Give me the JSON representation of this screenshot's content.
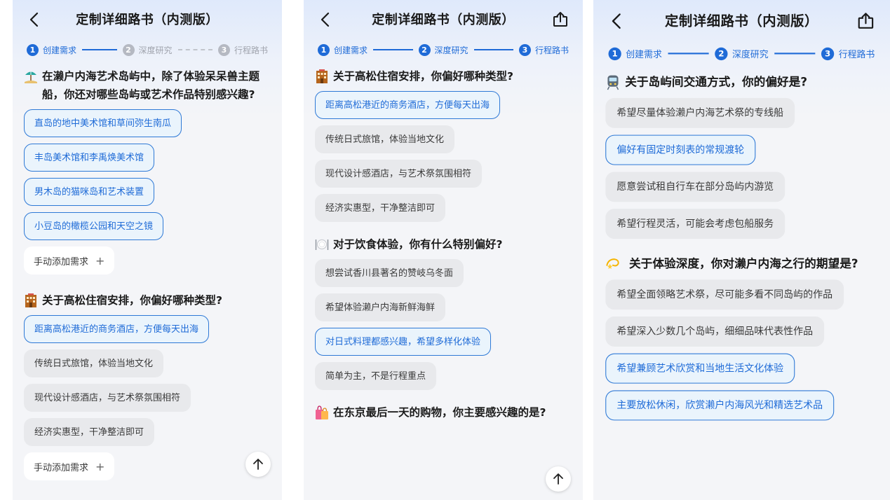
{
  "title": "定制详细路书（内测版）",
  "steps": [
    {
      "num": "1",
      "label": "创建需求"
    },
    {
      "num": "2",
      "label": "深度研究"
    },
    {
      "num": "3",
      "label": "行程路书"
    }
  ],
  "colors": {
    "accent": "#1f6bd7",
    "selected_bg": "#eaf4fc",
    "option_bg": "#e8e9ec"
  },
  "panel1": {
    "q1": {
      "icon": "beach-umbrella-icon",
      "text": "在濑户内海艺术岛屿中，除了体验呆呆兽主题船，你还对哪些岛屿或艺术作品特别感兴趣?",
      "options": [
        "直岛的地中美术馆和草间弥生南瓜",
        "丰岛美术馆和李禹焕美术馆",
        "男木岛的猫咪岛和艺术装置",
        "小豆岛的橄榄公园和天空之镜"
      ]
    },
    "add_label": "手动添加需求",
    "q2": {
      "icon": "hotel-icon",
      "text": "关于高松住宿安排，你偏好哪种类型?",
      "options": [
        "距离高松港近的商务酒店，方便每天出海",
        "传统日式旅馆，体验当地文化",
        "现代设计感酒店，与艺术祭氛围相符",
        "经济实惠型，干净整洁即可"
      ]
    }
  },
  "panel2": {
    "q1": {
      "icon": "hotel-icon",
      "text": "关于高松住宿安排，你偏好哪种类型?",
      "options": [
        "距离高松港近的商务酒店，方便每天出海",
        "传统日式旅馆，体验当地文化",
        "现代设计感酒店，与艺术祭氛围相符",
        "经济实惠型，干净整洁即可"
      ]
    },
    "q2": {
      "icon": "plate-cutlery-icon",
      "text": "对于饮食体验，你有什么特别偏好?",
      "options": [
        "想尝试香川县著名的赞岐乌冬面",
        "希望体验濑户内海新鲜海鲜",
        "对日式料理都感兴趣，希望多样化体验",
        "简单为主，不是行程重点"
      ]
    },
    "q3": {
      "icon": "shopping-bags-icon",
      "text": "在东京最后一天的购物，你主要感兴趣的是?"
    }
  },
  "panel3": {
    "q1": {
      "icon": "train-icon",
      "text": "关于岛屿间交通方式，你的偏好是?",
      "options": [
        "希望尽量体验濑户内海艺术祭的专线船",
        "偏好有固定时刻表的常规渡轮",
        "愿意尝试租自行车在部分岛屿内游览",
        "希望行程灵活，可能会考虑包船服务"
      ]
    },
    "q2": {
      "icon": "dizzy-star-icon",
      "text": "关于体验深度，你对濑户内海之行的期望是?",
      "options": [
        "希望全面领略艺术祭，尽可能多看不同岛屿的作品",
        "希望深入少数几个岛屿，细细品味代表性作品",
        "希望兼顾艺术欣赏和当地生活文化体验",
        "主要放松休闲，欣赏濑户内海风光和精选艺术品"
      ]
    }
  }
}
